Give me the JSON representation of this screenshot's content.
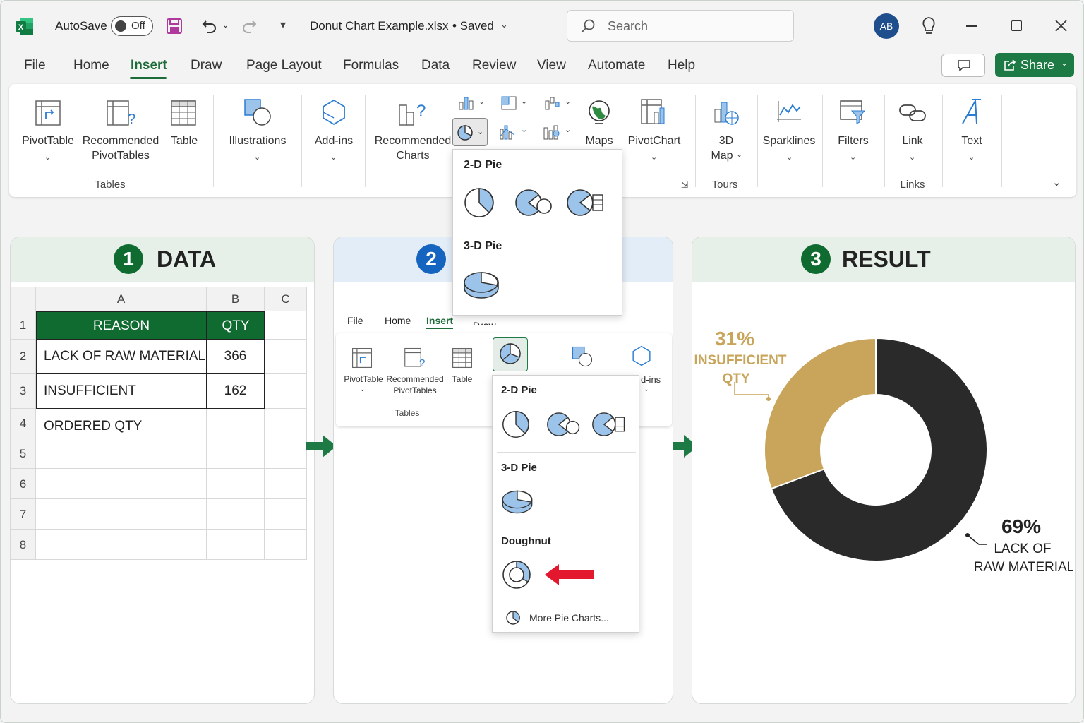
{
  "titlebar": {
    "autosave_label": "AutoSave",
    "toggle_state": "Off",
    "file_name": "Donut Chart Example.xlsx",
    "status": "• Saved",
    "search_placeholder": "Search",
    "avatar_initials": "AB"
  },
  "menu": {
    "tabs": [
      "File",
      "Home",
      "Insert",
      "Draw",
      "Page Layout",
      "Formulas",
      "Data",
      "Review",
      "View",
      "Automate",
      "Help"
    ],
    "active": "Insert",
    "share_label": "Share"
  },
  "ribbon": {
    "pivottable": "PivotTable",
    "rec_pivot_1": "Recommended",
    "rec_pivot_2": "PivotTables",
    "table": "Table",
    "tables_group": "Tables",
    "illustrations": "Illustrations",
    "addins": "Add-ins",
    "rec_charts_1": "Recommended",
    "rec_charts_2": "Charts",
    "maps": "Maps",
    "pivotchart": "PivotChart",
    "map3d_1": "3D",
    "map3d_2": "Map",
    "tours_group": "Tours",
    "sparklines": "Sparklines",
    "filters": "Filters",
    "link": "Link",
    "links_group": "Links",
    "text": "Text"
  },
  "pie_dropdown_top": {
    "section_2d": "2-D Pie",
    "section_3d": "3-D Pie"
  },
  "panels": {
    "data": {
      "number": "1",
      "title": "DATA"
    },
    "steps": {
      "number": "2"
    },
    "result": {
      "number": "3",
      "title": "RESULT"
    }
  },
  "sheet": {
    "col_headers": [
      "A",
      "B",
      "C"
    ],
    "row_headers": [
      "1",
      "2",
      "3",
      "4",
      "5",
      "6",
      "7",
      "8"
    ],
    "header_row": [
      "REASON",
      "QTY"
    ],
    "rows": [
      [
        "LACK OF RAW MATERIAL",
        "366"
      ],
      [
        "INSUFFICIENT ORDERED QTY",
        "162"
      ]
    ]
  },
  "mini_ribbon": {
    "tabs": [
      "File",
      "Home",
      "Insert",
      "Draw"
    ],
    "pivottable": "PivotTable",
    "rec_1": "Recommended",
    "rec_2": "PivotTables",
    "table": "Table",
    "tables_group": "Tables",
    "addins_partial": "d-ins"
  },
  "pie_dropdown_step": {
    "section_2d": "2-D Pie",
    "section_3d": "3-D Pie",
    "section_doughnut": "Doughnut",
    "more": "More Pie Charts..."
  },
  "colors": {
    "excel_green": "#1e6b3a",
    "header_green": "#0f6b2f",
    "badge_blue": "#1565c0",
    "donut_dark": "#2a2a2a",
    "donut_gold": "#c8a55a",
    "red_arrow": "#e3172d"
  },
  "chart_data": {
    "type": "donut",
    "categories": [
      "LACK OF RAW MATERIAL",
      "INSUFFICIENT ORDERED QTY"
    ],
    "values": [
      366,
      162
    ],
    "percent_labels": [
      "69%",
      "31%"
    ],
    "slice_labels": [
      {
        "line1": "LACK OF",
        "line2": "RAW MATERIAL"
      },
      {
        "line1": "INSUFFICIENT",
        "line2": "QTY"
      }
    ],
    "colors": [
      "#2a2a2a",
      "#c8a55a"
    ]
  }
}
